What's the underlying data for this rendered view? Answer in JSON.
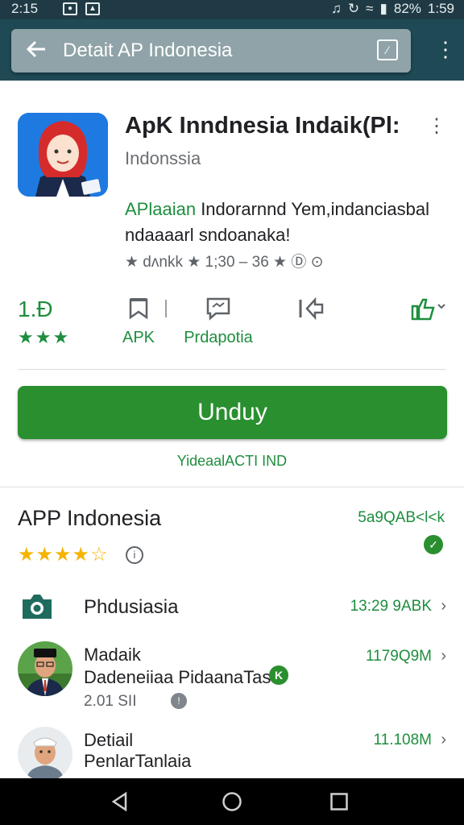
{
  "status": {
    "time": "2:15",
    "battery": "82%",
    "clock_right": "1:59"
  },
  "toolbar": {
    "title": "Detait AP Indonesia"
  },
  "app": {
    "title": "ApK Inndnesia Indaik(Pl:",
    "developer": "Indonssia",
    "desc_green": "APlaaian",
    "desc_rest_1": " Indorarnnd Yem,indanciasbal",
    "desc_line_2": "ndaaaarl sndoanaka!",
    "meta": "★ dʌnkk ★ 1;30 – 36 ★ Ⓓ ⊙"
  },
  "stats": {
    "rating": "1.Ɖ",
    "rating_stars": "★★★",
    "apk_label": "APK",
    "prdapotia_label": "Prdapotia"
  },
  "install": {
    "label": "Unduy",
    "note": "YideaalACTI IND"
  },
  "section": {
    "title": "APP Indonesia",
    "stars": "★★★★☆",
    "info": "i",
    "right_text": "5a9QAB<l<k",
    "badge": "✓"
  },
  "rows": [
    {
      "label": "Phdusiasia",
      "size": "13:29 9ABK"
    },
    {
      "label": "Madaik",
      "sub": "Dadeneiiaa PidaanaTas",
      "sub2": "2.01 SII",
      "size": "1179Q9M"
    },
    {
      "label": "Detiail",
      "sub": "PenlarTanlaia",
      "size": "11.108M"
    }
  ],
  "colors": {
    "accent": "#2a8f2f",
    "toolbar": "#1f4a55",
    "status": "#1f3a45"
  }
}
